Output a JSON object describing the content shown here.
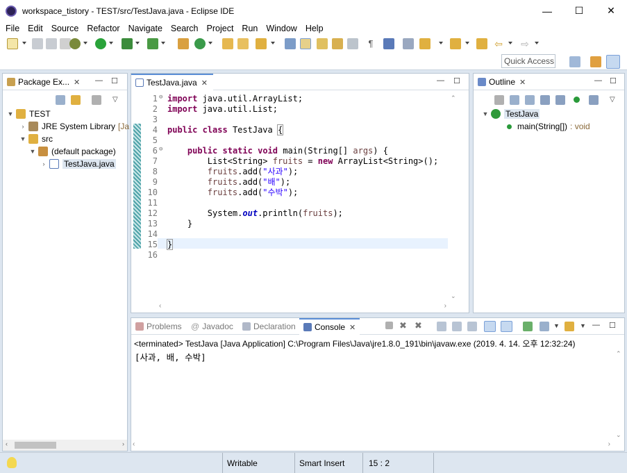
{
  "window": {
    "title": "workspace_tistory - TEST/src/TestJava.java - Eclipse IDE",
    "minimize": "—",
    "maximize": "☐",
    "close": "✕"
  },
  "menu": [
    "File",
    "Edit",
    "Source",
    "Refactor",
    "Navigate",
    "Search",
    "Project",
    "Run",
    "Window",
    "Help"
  ],
  "toolbar": {
    "quick_access": "Quick Access"
  },
  "package_explorer": {
    "tab_label": "Package Ex...",
    "items": [
      {
        "label": "TEST",
        "extra": ""
      },
      {
        "label": "JRE System Library",
        "extra": "[Ja"
      },
      {
        "label": "src",
        "extra": ""
      },
      {
        "label": "(default package)",
        "extra": ""
      },
      {
        "label": "TestJava.java",
        "extra": ""
      }
    ]
  },
  "editor": {
    "tab_label": "TestJava.java",
    "line_numbers": [
      "1",
      "2",
      "3",
      "4",
      "5",
      "6",
      "7",
      "8",
      "9",
      "10",
      "11",
      "12",
      "13",
      "14",
      "15",
      "16"
    ]
  },
  "outline": {
    "tab_label": "Outline",
    "class_name": "TestJava",
    "method": "main(String[])",
    "method_type": ": void"
  },
  "bottom": {
    "tabs": [
      "Problems",
      "Javadoc",
      "Declaration",
      "Console"
    ],
    "console_header": "<terminated> TestJava [Java Application] C:\\Program Files\\Java\\jre1.8.0_191\\bin\\javaw.exe (2019. 4. 14. 오후 12:32:24)",
    "console_output": "[사과, 배, 수박]"
  },
  "status": {
    "writable": "Writable",
    "insert_mode": "Smart Insert",
    "position": "15 : 2"
  },
  "colors": {
    "background": "#dde6f0",
    "selection_tab": "#5b8ed6",
    "keyword": "#7f0055",
    "string": "#2a00ff",
    "current_line": "#e8f2fe"
  },
  "code": {
    "l1": [
      "import",
      " java.util.ArrayList;"
    ],
    "l2": [
      "import",
      " java.util.List;"
    ],
    "l4": [
      "public",
      " ",
      "class",
      " TestJava ",
      "{"
    ],
    "l6": [
      "    ",
      "public",
      " ",
      "static",
      " ",
      "void",
      " main(String[] ",
      "args",
      ") {"
    ],
    "l7": [
      "        List<String> ",
      "fruits",
      " = ",
      "new",
      " ArrayList<String>();"
    ],
    "l8": [
      "        ",
      "fruits",
      ".add(",
      "\"사과\"",
      ");"
    ],
    "l9": [
      "        ",
      "fruits",
      ".add(",
      "\"배\"",
      ");"
    ],
    "l10": [
      "        ",
      "fruits",
      ".add(",
      "\"수박\"",
      ");"
    ],
    "l12": [
      "        System.",
      "out",
      ".println(",
      "fruits",
      ");"
    ],
    "l13": [
      "    }"
    ],
    "l15": [
      "}"
    ]
  }
}
